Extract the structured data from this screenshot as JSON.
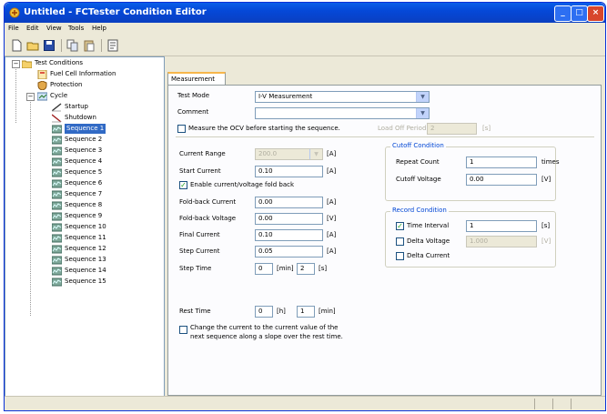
{
  "window": {
    "title": "Untitled - FCTester Condition Editor",
    "minimize": "_",
    "maximize": "□",
    "close": "×"
  },
  "menu": [
    "File",
    "Edit",
    "View",
    "Tools",
    "Help"
  ],
  "toolbar": [
    "new-icon",
    "open-icon",
    "save-icon",
    "copy-icon",
    "paste-icon",
    "properties-icon"
  ],
  "tree": {
    "root": "Test Conditions",
    "fuel_cell": "Fuel Cell Information",
    "protection": "Protection",
    "cycle": "Cycle",
    "startup": "Startup",
    "shutdown": "Shutdown",
    "sequences": [
      "Sequence 1",
      "Sequence 2",
      "Sequence 3",
      "Sequence 4",
      "Sequence 5",
      "Sequence 6",
      "Sequence 7",
      "Sequence 8",
      "Sequence 9",
      "Sequence 10",
      "Sequence 11",
      "Sequence 12",
      "Sequence 13",
      "Sequence 14",
      "Sequence 15"
    ],
    "selected": "Sequence 1"
  },
  "tab": "Measurement",
  "form": {
    "test_mode_label": "Test Mode",
    "test_mode_value": "I-V Measurement",
    "comment_label": "Comment",
    "comment_value": "",
    "measure_ocv_label": "Measure the OCV before starting the sequence.",
    "load_off_label": "Load Off Period",
    "load_off_value": "2",
    "load_off_unit": "[s]",
    "current_range_label": "Current Range",
    "current_range_value": "200.0",
    "current_range_unit": "[A]",
    "start_current_label": "Start Current",
    "start_current_value": "0.10",
    "start_current_unit": "[A]",
    "enable_foldback_label": "Enable current/voltage fold back",
    "foldback_current_label": "Fold-back Current",
    "foldback_current_value": "0.00",
    "foldback_current_unit": "[A]",
    "foldback_voltage_label": "Fold-back Voltage",
    "foldback_voltage_value": "0.00",
    "foldback_voltage_unit": "[V]",
    "final_current_label": "Final Current",
    "final_current_value": "0.10",
    "final_current_unit": "[A]",
    "step_current_label": "Step Current",
    "step_current_value": "0.05",
    "step_current_unit": "[A]",
    "step_time_label": "Step Time",
    "step_time_min": "0",
    "step_time_min_unit": "[min]",
    "step_time_sec": "2",
    "step_time_sec_unit": "[s]",
    "rest_time_label": "Rest Time",
    "rest_time_h": "0",
    "rest_time_h_unit": "[h]",
    "rest_time_min": "1",
    "rest_time_min_unit": "[min]",
    "change_current_label_1": "Change the current to the current value of the",
    "change_current_label_2": "next sequence along a slope over the rest time."
  },
  "cutoff": {
    "title": "Cutoff Condition",
    "repeat_label": "Repeat Count",
    "repeat_value": "1",
    "repeat_unit": "times",
    "voltage_label": "Cutoff Voltage",
    "voltage_value": "0.00",
    "voltage_unit": "[V]"
  },
  "record": {
    "title": "Record Condition",
    "time_label": "Time Interval",
    "time_value": "1",
    "time_unit": "[s]",
    "delta_voltage_label": "Delta Voltage",
    "delta_voltage_value": "1.000",
    "delta_voltage_unit": "[V]",
    "delta_current_label": "Delta Current"
  },
  "colors": {
    "titlebar": "#0548d8",
    "selection": "#316ac5",
    "group_title": "#0046d5"
  }
}
